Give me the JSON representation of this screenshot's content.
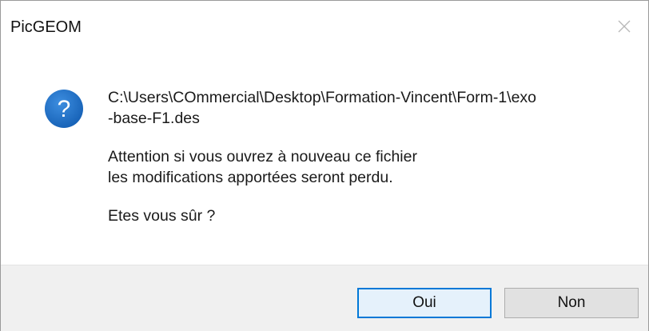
{
  "window": {
    "title": "PicGEOM"
  },
  "icons": {
    "close": "close-icon",
    "question": "question-icon",
    "accent": "#1e73c8"
  },
  "message": {
    "path": "C:\\Users\\COmmercial\\Desktop\\Formation-Vincent\\Form-1\\exo\n-base-F1.des",
    "warning": "Attention si vous ouvrez à nouveau ce fichier\nles modifications apportées seront perdu.",
    "question": "Etes vous sûr ?"
  },
  "buttons": {
    "yes_label": "Oui",
    "no_label": "Non",
    "default": "yes"
  },
  "colors": {
    "focus_border": "#0078d7",
    "footer_bg": "#f0f0f0"
  }
}
